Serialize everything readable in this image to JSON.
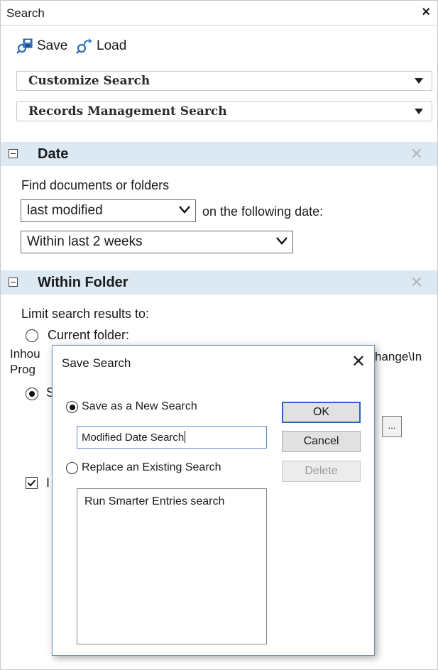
{
  "panel": {
    "title": "Search",
    "close_glyph": "×"
  },
  "toolbar": {
    "save_label": "Save",
    "load_label": "Load",
    "save_icon": "save-search-icon",
    "load_icon": "load-search-icon"
  },
  "dropdowns": {
    "customize": "Customize Search",
    "records": "Records Management Search"
  },
  "date_section": {
    "title": "Date",
    "find_label": "Find documents or folders",
    "modified_value": "last modified",
    "following_date_label": "on the following date:",
    "range_value": "Within last 2 weeks"
  },
  "folder_section": {
    "title": "Within Folder",
    "limit_label": "Limit search results to:",
    "current_folder_label": "Current folder:",
    "path_left": "Inhou",
    "path_left_2": "Prog",
    "path_right": "hange\\In",
    "option_s_partial": "S",
    "checkbox_partial": "I",
    "ellipsis_label": "..."
  },
  "dialog": {
    "title": "Save Search",
    "close_glyph": "✕",
    "save_new_label": "Save as a New Search",
    "name_value": "Modified Date Search",
    "replace_label": "Replace an Existing Search",
    "existing_searches": [
      "Run Smarter Entries search"
    ],
    "ok_label": "OK",
    "cancel_label": "Cancel",
    "delete_label": "Delete"
  },
  "colors": {
    "section_header_bg": "#dce8f2",
    "accent_blue": "#2a64b5"
  }
}
